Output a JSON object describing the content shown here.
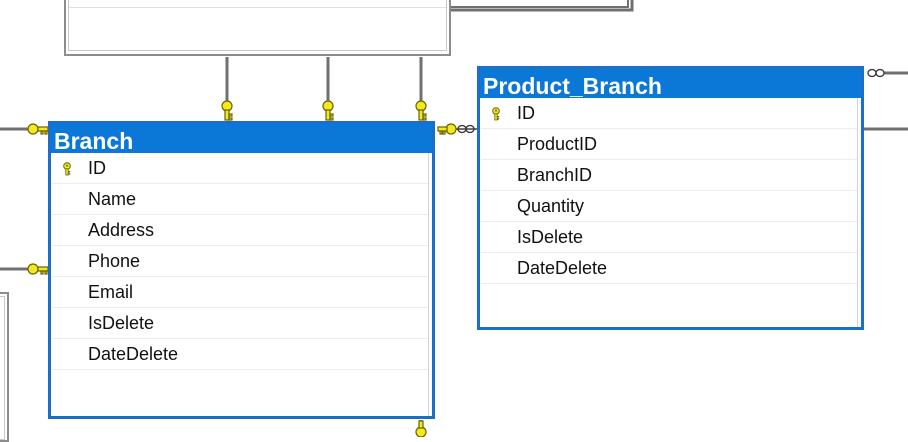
{
  "diagram": {
    "tables": [
      {
        "id": "branch",
        "title": "Branch",
        "columns": [
          {
            "name": "ID",
            "primary_key": true
          },
          {
            "name": "Name",
            "primary_key": false
          },
          {
            "name": "Address",
            "primary_key": false
          },
          {
            "name": "Phone",
            "primary_key": false
          },
          {
            "name": "Email",
            "primary_key": false
          },
          {
            "name": "IsDelete",
            "primary_key": false
          },
          {
            "name": "DateDelete",
            "primary_key": false
          }
        ]
      },
      {
        "id": "product_branch",
        "title": "Product_Branch",
        "columns": [
          {
            "name": "ID",
            "primary_key": true
          },
          {
            "name": "ProductID",
            "primary_key": false
          },
          {
            "name": "BranchID",
            "primary_key": false
          },
          {
            "name": "Quantity",
            "primary_key": false
          },
          {
            "name": "IsDelete",
            "primary_key": false
          },
          {
            "name": "DateDelete",
            "primary_key": false
          }
        ]
      }
    ],
    "colors": {
      "title_bar": "#0b78d7",
      "table_border": "#1b6fc9",
      "key_fill": "#f2ea1e",
      "key_stroke": "#6b6300",
      "connector": "#707070"
    }
  }
}
